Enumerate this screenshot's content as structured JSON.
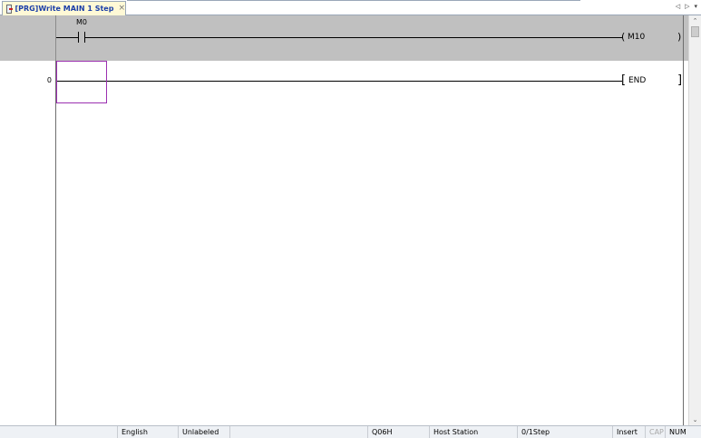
{
  "tab": {
    "title": "[PRG]Write MAIN 1 Step",
    "close_glyph": "×",
    "nav_left": "◁",
    "nav_right": "▷",
    "nav_menu": "▾"
  },
  "ladder": {
    "header_rung": {
      "contact_device": "M0",
      "coil_open": "(",
      "coil_device": "M10",
      "coil_close": ")"
    },
    "rungs": [
      {
        "step": "0",
        "instruction_open": "[",
        "instruction": "END",
        "instruction_close": "]"
      }
    ]
  },
  "scrollbar": {
    "up_glyph": "⌃",
    "down_glyph": "⌄"
  },
  "statusbar": {
    "language": "English",
    "label_state": "Unlabeled",
    "cpu": "Q06H",
    "station": "Host Station",
    "steps": "0/1Step",
    "mode": "Insert",
    "cap": "CAP",
    "num": "NUM"
  },
  "colors": {
    "header_band": "#c0c0c0",
    "cursor": "#9b30b0",
    "tab_bg": "#fff9d6",
    "tab_title": "#1a3ea8"
  },
  "icons": {
    "tab": "ladder-program-icon",
    "close": "close-icon",
    "scroll_left": "arrow-left-icon",
    "scroll_right": "arrow-right-icon",
    "menu": "dropdown-icon"
  }
}
